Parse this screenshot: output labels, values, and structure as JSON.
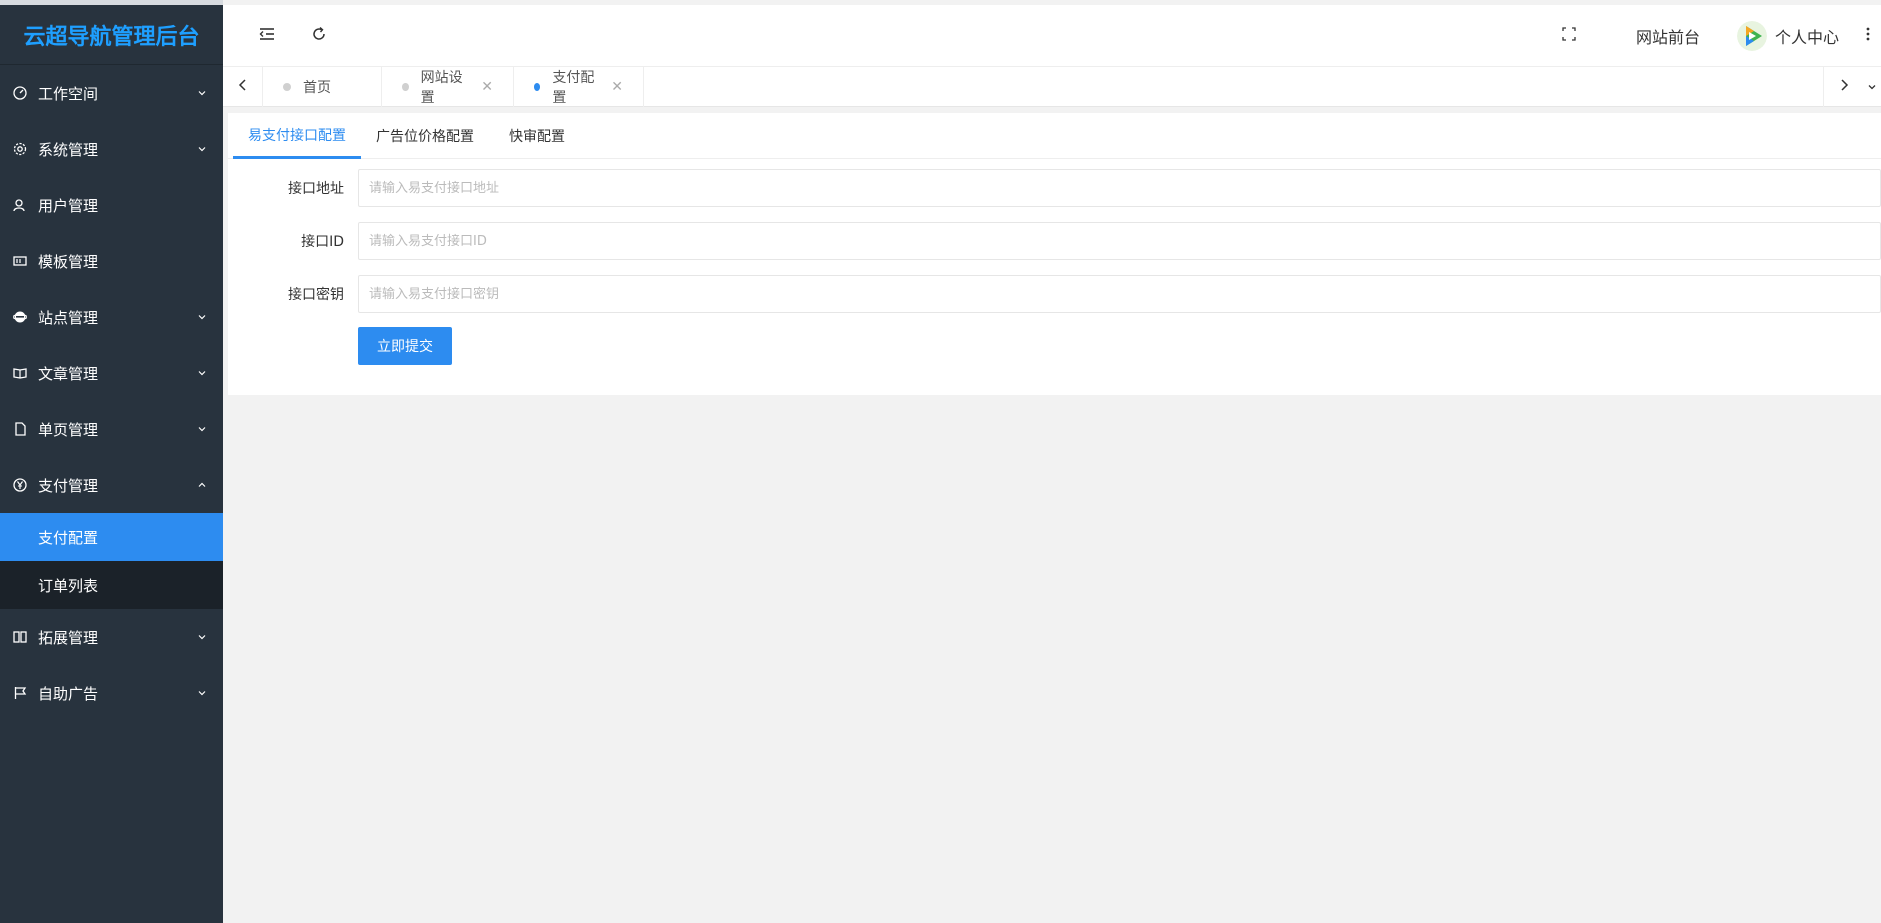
{
  "app": {
    "title": "云超导航管理后台"
  },
  "sidebar": {
    "items": [
      {
        "label": "工作空间",
        "icon": "dashboard-icon",
        "expandable": true
      },
      {
        "label": "系统管理",
        "icon": "gear-icon",
        "expandable": true
      },
      {
        "label": "用户管理",
        "icon": "user-icon",
        "expandable": false
      },
      {
        "label": "模板管理",
        "icon": "template-icon",
        "expandable": false
      },
      {
        "label": "站点管理",
        "icon": "ie-icon",
        "expandable": true
      },
      {
        "label": "文章管理",
        "icon": "book-icon",
        "expandable": true
      },
      {
        "label": "单页管理",
        "icon": "file-icon",
        "expandable": true
      },
      {
        "label": "支付管理",
        "icon": "yen-icon",
        "expandable": true,
        "expanded": true
      },
      {
        "label": "拓展管理",
        "icon": "columns-icon",
        "expandable": true
      },
      {
        "label": "自助广告",
        "icon": "flag-icon",
        "expandable": true
      }
    ],
    "pay_submenu": [
      {
        "label": "支付配置",
        "active": true
      },
      {
        "label": "订单列表",
        "active": false
      }
    ]
  },
  "header": {
    "fullscreen_icon": "fullscreen-icon",
    "frontend_label": "网站前台",
    "profile_label": "个人中心",
    "more_icon": "more-vertical-icon"
  },
  "tabs": [
    {
      "label": "首页",
      "closable": false,
      "active": false
    },
    {
      "label": "网站设置",
      "closable": true,
      "active": false
    },
    {
      "label": "支付配置",
      "closable": true,
      "active": true
    }
  ],
  "subtabs": [
    {
      "label": "易支付接口配置",
      "active": true
    },
    {
      "label": "广告位价格配置",
      "active": false
    },
    {
      "label": "快审配置",
      "active": false
    }
  ],
  "form": {
    "api_url": {
      "label": "接口地址",
      "value": "",
      "placeholder": "请输入易支付接口地址"
    },
    "api_id": {
      "label": "接口ID",
      "value": "",
      "placeholder": "请输入易支付接口ID"
    },
    "api_key": {
      "label": "接口密钥",
      "value": "",
      "placeholder": "请输入易支付接口密钥"
    },
    "submit_label": "立即提交"
  },
  "colors": {
    "accent": "#2d8cf0",
    "sidebar_bg": "#28333e",
    "logo_color": "#1e9fff"
  }
}
